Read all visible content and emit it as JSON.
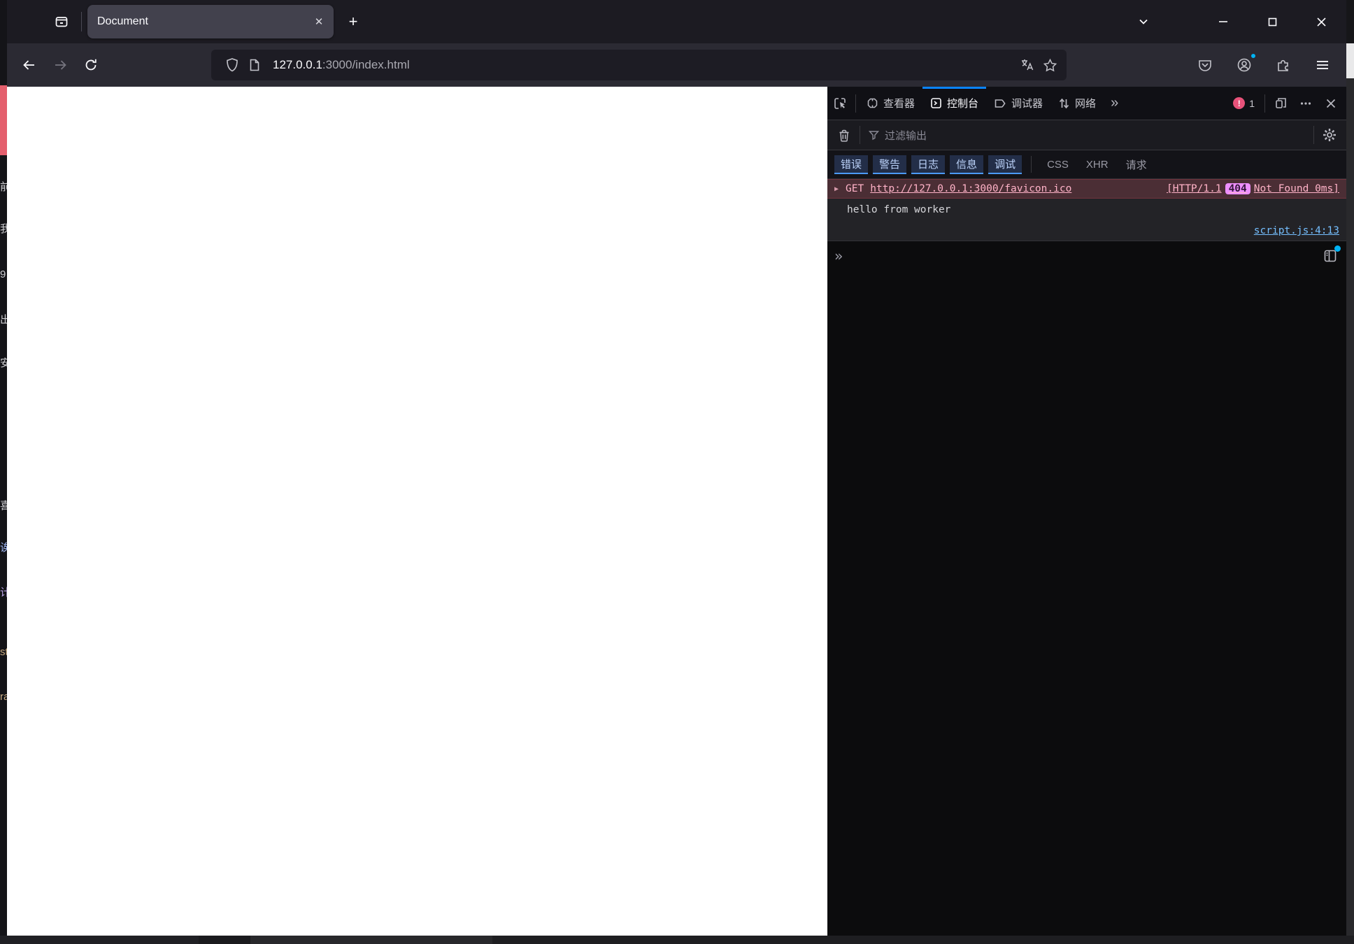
{
  "window": {
    "tab_title": "Document",
    "new_tab_glyph": "+",
    "close_glyph": "✕"
  },
  "urlbar": {
    "host": "127.0.0.1",
    "path": ":3000/index.html"
  },
  "background_window": {
    "fragments": [
      "前",
      "我",
      "9",
      "出",
      "安",
      "喜",
      "诶",
      "计",
      "st",
      "ra"
    ]
  },
  "devtools": {
    "tabs": [
      {
        "label": "查看器"
      },
      {
        "label": "控制台"
      },
      {
        "label": "调试器"
      },
      {
        "label": "网络"
      }
    ],
    "more_tabs_glyph": "»",
    "error_badge": {
      "glyph": "!",
      "count": "1"
    },
    "filter_placeholder": "过滤输出",
    "level_filters": [
      "错误",
      "警告",
      "日志",
      "信息",
      "调试"
    ],
    "type_filters": [
      "CSS",
      "XHR",
      "请求"
    ],
    "console": {
      "error": {
        "twisty_glyph": "▶",
        "method": "GET",
        "url": "http://127.0.0.1:3000/favicon.ico",
        "status_prefix": "[HTTP/1.1",
        "status_code": "404",
        "status_suffix": "Not Found 0ms]"
      },
      "log": {
        "message": "hello from worker",
        "location": "script.js:4:13"
      },
      "input_prompt": "»"
    }
  },
  "icons": {
    "star_glyph": "☆",
    "back_glyph": "←",
    "forward_glyph": "→"
  },
  "colors": {
    "accent_blue": "#0a84ff",
    "devtools_link_blue": "#75bfff",
    "error_row_bg": "#4b2e35",
    "error_row_text": "#ffb3c8",
    "status_404_badge_bg": "#ee8fff",
    "error_badge_bg": "#e8527a",
    "active_tab_bg": "#42414d",
    "toolbar_bg": "#2b2a33",
    "page_bg": "#ffffff"
  }
}
